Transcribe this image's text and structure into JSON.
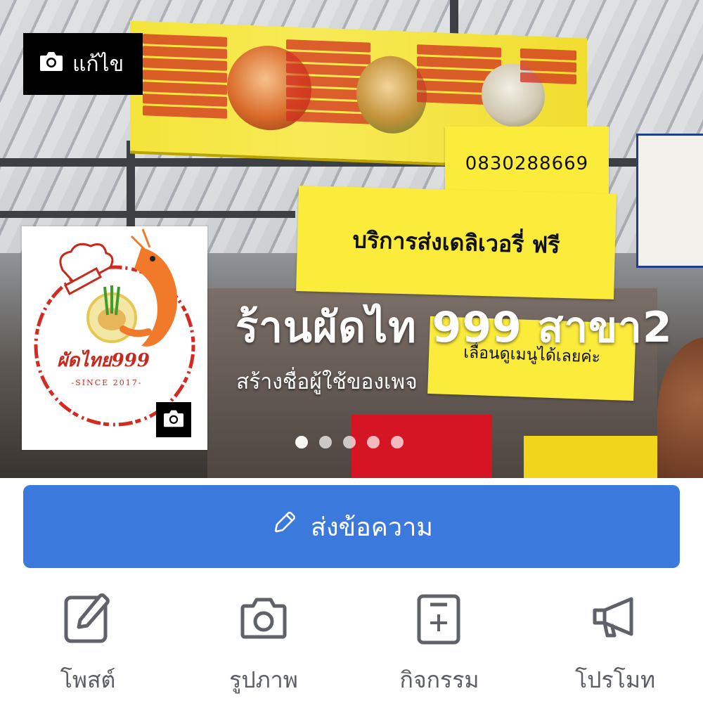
{
  "cover": {
    "edit_label": "แก้ไข",
    "phone_note": "0830288669",
    "delivery_note": "บริการส่งเดลิเวอรี่ ฟรี",
    "scroll_note": "เลื่อนดูเมนูได้เลยค่ะ",
    "page_name": "ร้านผัดไท 999 สาขา2",
    "username_prompt": "สร้างชื่อผู้ใช้ของเพจ",
    "carousel_count": 5
  },
  "profile": {
    "logo_text": "ผัดไทย999",
    "logo_since": "-SINCE 2017-"
  },
  "message_button": {
    "label": "ส่งข้อความ",
    "color": "#3b79dd"
  },
  "actions": [
    {
      "label": "โพสต์",
      "icon": "pencil-square-icon"
    },
    {
      "label": "รูปภาพ",
      "icon": "camera-icon"
    },
    {
      "label": "กิจกรรม",
      "icon": "calendar-plus-icon"
    },
    {
      "label": "โปรโมท",
      "icon": "megaphone-icon"
    }
  ]
}
